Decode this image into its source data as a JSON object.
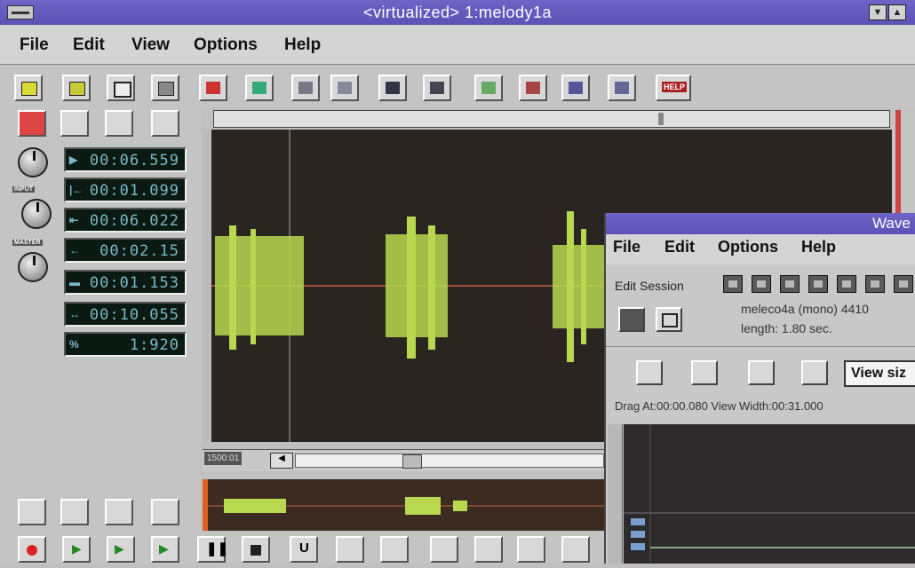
{
  "window": {
    "title": "<virtualized> 1:melody1a"
  },
  "title_buttons": {
    "min": "▼",
    "max": "▲"
  },
  "menu": [
    {
      "label": "File"
    },
    {
      "label": "Edit"
    },
    {
      "label": "View"
    },
    {
      "label": "Options"
    },
    {
      "label": "Help"
    }
  ],
  "toolbar": {
    "help_label": "HELP"
  },
  "knobs": {
    "input": "INPUT",
    "master": "MASTER"
  },
  "displays": [
    {
      "prefix": "▶",
      "value": "00:06.559"
    },
    {
      "prefix": "|←",
      "value": "00:01.099"
    },
    {
      "prefix": "⇤",
      "value": "00:06.022"
    },
    {
      "prefix": "←",
      "value": "00:02.15"
    },
    {
      "prefix": "▬",
      "value": "00:01.153"
    },
    {
      "prefix": "↔",
      "value": "00:10.055"
    },
    {
      "prefix": "%",
      "value": "1:920"
    }
  ],
  "overview": {
    "zoom_label": "1500:01"
  },
  "wave_window": {
    "title": "Wave",
    "menu": [
      {
        "label": "File"
      },
      {
        "label": "Edit"
      },
      {
        "label": "Options"
      },
      {
        "label": "Help"
      }
    ],
    "edit_session_label": "Edit Session",
    "file_info": "meleco4a (mono) 4410",
    "length": "length: 1.80 sec.",
    "view_size_button": "View siz",
    "status": "Drag At:00:00.080  View Width:00:31.000"
  }
}
